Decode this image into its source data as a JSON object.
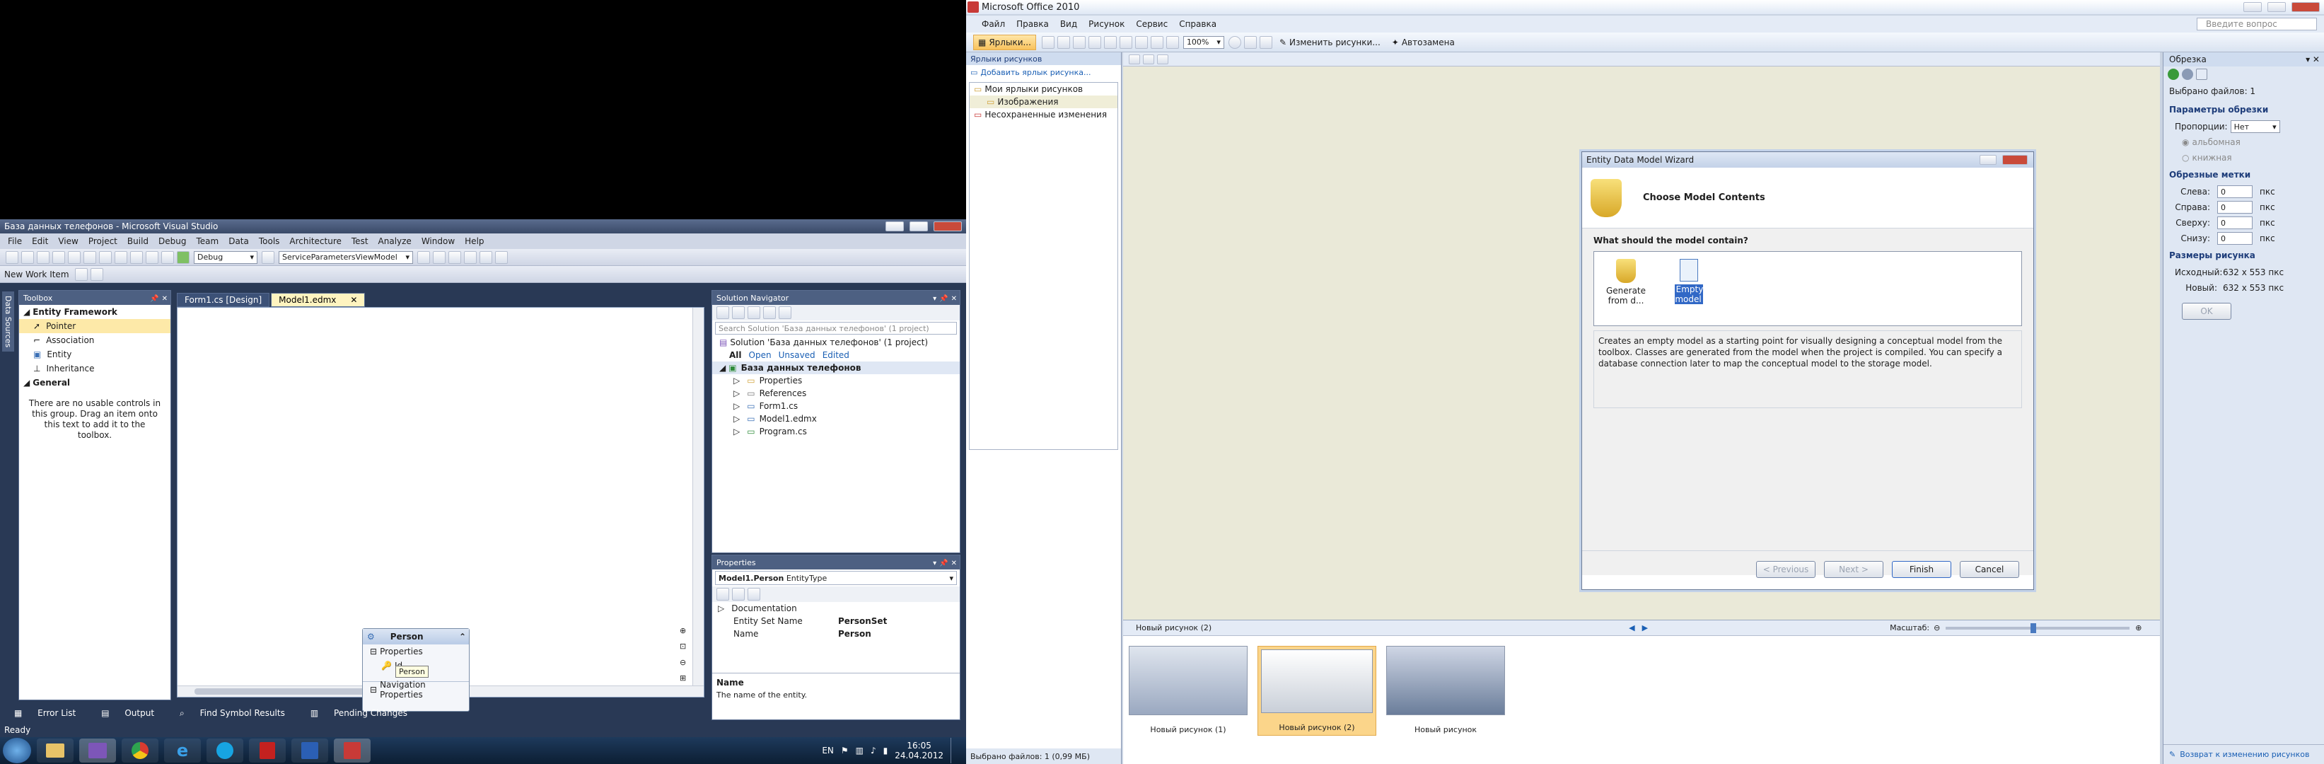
{
  "vs": {
    "title": "База данных телефонов - Microsoft Visual Studio",
    "menu": [
      "File",
      "Edit",
      "View",
      "Project",
      "Build",
      "Debug",
      "Team",
      "Data",
      "Tools",
      "Architecture",
      "Test",
      "Analyze",
      "Window",
      "Help"
    ],
    "config_combo": "Debug",
    "platform_combo": "ServiceParametersViewModel",
    "new_work_item": "New Work Item",
    "side_label": "Data Sources",
    "toolbox": {
      "title": "Toolbox",
      "group1": "Entity Framework",
      "items": [
        "Pointer",
        "Association",
        "Entity",
        "Inheritance"
      ],
      "group2": "General",
      "empty_text": "There are no usable controls in this group. Drag an item onto this text to add it to the toolbox."
    },
    "tabs": [
      "Form1.cs [Design]",
      "Model1.edmx"
    ],
    "entity": {
      "name": "Person",
      "properties": "Properties",
      "prop_id": "Id",
      "nav": "Navigation Properties",
      "tooltip": "Person"
    },
    "solution": {
      "title": "Solution Navigator",
      "search_placeholder": "Search Solution 'База данных телефонов' (1 project)",
      "solution_line": "Solution 'База данных телефонов' (1 project)",
      "filters": [
        "All",
        "Open",
        "Unsaved",
        "Edited"
      ],
      "project": "База данных телефонов",
      "items": [
        "Properties",
        "References",
        "Form1.cs",
        "Model1.edmx",
        "Program.cs"
      ]
    },
    "properties": {
      "title": "Properties",
      "selector": "Model1.Person",
      "selector_type": "EntityType",
      "rows": [
        {
          "name": "Documentation",
          "value": ""
        },
        {
          "name": "Entity Set Name",
          "value": "PersonSet"
        },
        {
          "name": "Name",
          "value": "Person"
        }
      ],
      "desc_title": "Name",
      "desc_text": "The name of the entity."
    },
    "bottom_tabs": [
      "Error List",
      "Output",
      "Find Symbol Results",
      "Pending Changes"
    ],
    "status": "Ready"
  },
  "taskbar": {
    "lang": "EN",
    "time": "16:05",
    "date": "24.04.2012"
  },
  "office": {
    "title": "Microsoft Office 2010",
    "menu": [
      "Файл",
      "Правка",
      "Вид",
      "Рисунок",
      "Сервис",
      "Справка"
    ],
    "question_placeholder": "Введите вопрос",
    "toolbar": {
      "shortcuts": "Ярлыки...",
      "zoom": "100%",
      "edit_pictures": "Изменить рисунки...",
      "autocorrect": "Автозамена"
    },
    "left_panel": {
      "title": "Ярлыки рисунков",
      "add_link": "Добавить ярлык рисунка...",
      "my_shortcuts": "Мои ярлыки рисунков",
      "images": "Изображения",
      "unsaved": "Несохраненные изменения",
      "status": "Выбрано файлов: 1 (0,99 МБ)"
    },
    "wizard": {
      "title": "Entity Data Model Wizard",
      "header": "Choose Model Contents",
      "question": "What should the model contain?",
      "option1": "Generate from d...",
      "option2": "Empty model",
      "description": "Creates an empty model as a starting point for visually designing a conceptual model from the toolbox. Classes are generated from the model when the project is compiled. You can specify a database connection later to map the conceptual model to the storage model.",
      "btn_prev": "< Previous",
      "btn_next": "Next >",
      "btn_finish": "Finish",
      "btn_cancel": "Cancel"
    },
    "strip": {
      "current": "Новый рисунок (2)",
      "zoom_label": "Масштаб:",
      "thumbs": [
        "Новый рисунок (1)",
        "Новый рисунок (2)",
        "Новый рисунок"
      ]
    },
    "right_panel": {
      "title": "Обрезка",
      "selected": "Выбрано файлов: 1",
      "section1": "Параметры обрезки",
      "proportions_label": "Пропорции:",
      "proportions_value": "Нет",
      "landscape": "альбомная",
      "portrait": "книжная",
      "section2": "Обрезные метки",
      "fields": [
        {
          "label": "Слева:",
          "value": "0",
          "unit": "пкс"
        },
        {
          "label": "Справа:",
          "value": "0",
          "unit": "пкс"
        },
        {
          "label": "Сверху:",
          "value": "0",
          "unit": "пкс"
        },
        {
          "label": "Снизу:",
          "value": "0",
          "unit": "пкс"
        }
      ],
      "section3": "Размеры рисунка",
      "original_label": "Исходный:",
      "original_value": "632 x 553 пкс",
      "new_label": "Новый:",
      "new_value": "632 x 553 пкс",
      "ok": "OK",
      "back_link": "Возврат к изменению рисунков"
    }
  }
}
